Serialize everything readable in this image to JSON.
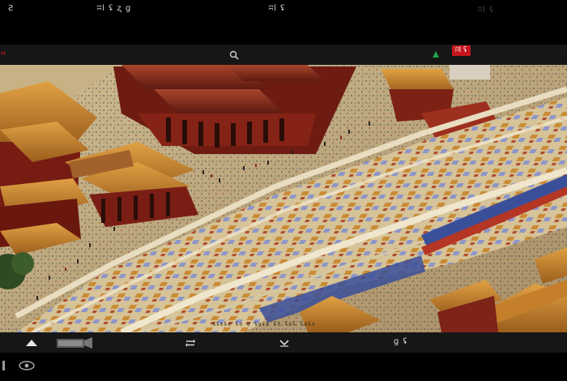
{
  "top_bar": {
    "text_left": "Ƨ",
    "text_center_left": "ʭl ʢ ʐ ɡ",
    "text_center_right": "ʭl ʢ",
    "text_right": "ʭl ʢ"
  },
  "hud": {
    "left_marker": "ʜ",
    "status_badge": "ʭl ʢ"
  },
  "map": {
    "caption": "ɞʢɞʢɞ ʢɞ ɞ ʢɞʢɞ ʢɞ ʢɞʢ ʢɞʢɞ"
  },
  "bottom_bar": {
    "right_label": "ɡ ʢ"
  },
  "colors": {
    "roof_gold": "#c9862a",
    "roof_red": "#8a2417",
    "wall_red": "#7a1d14",
    "plaza": "#c9b68d",
    "stall_blue": "#6c7fc8",
    "water": "#3a4f9a",
    "hud_bg": "#161616"
  },
  "icons": {
    "search": "search-icon",
    "flag": "flag-icon",
    "chevron_up": "chevron-up-icon",
    "tool": "camera-icon",
    "swap": "swap-icon",
    "chevron_down": "chevron-down-icon",
    "exit": "exit-icon",
    "eye": "eye-icon"
  }
}
